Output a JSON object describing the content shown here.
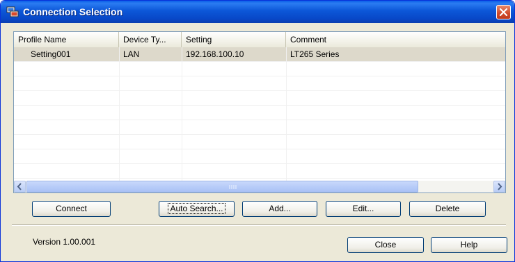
{
  "window": {
    "title": "Connection Selection"
  },
  "list": {
    "columns": [
      "Profile Name",
      "Device Ty...",
      "Setting",
      "Comment"
    ],
    "rows": [
      {
        "profile": "Setting001",
        "device": "LAN",
        "setting": "192.168.100.10",
        "comment": "LT265 Series"
      }
    ]
  },
  "buttons": {
    "connect": "Connect",
    "auto_search": "Auto Search...",
    "add": "Add...",
    "edit": "Edit...",
    "delete": "Delete",
    "close": "Close",
    "help": "Help"
  },
  "footer": {
    "version": "Version 1.00.001"
  },
  "icons": {
    "app": "connection-app-icon",
    "close": "close-icon",
    "scroll_left": "scroll-left-arrow-icon",
    "scroll_right": "scroll-right-arrow-icon"
  },
  "colors": {
    "title_bar": "#0a5ee8",
    "dialog_bg": "#ece9d8",
    "close_button": "#d04a2b",
    "selection": "#ddd9cb"
  }
}
